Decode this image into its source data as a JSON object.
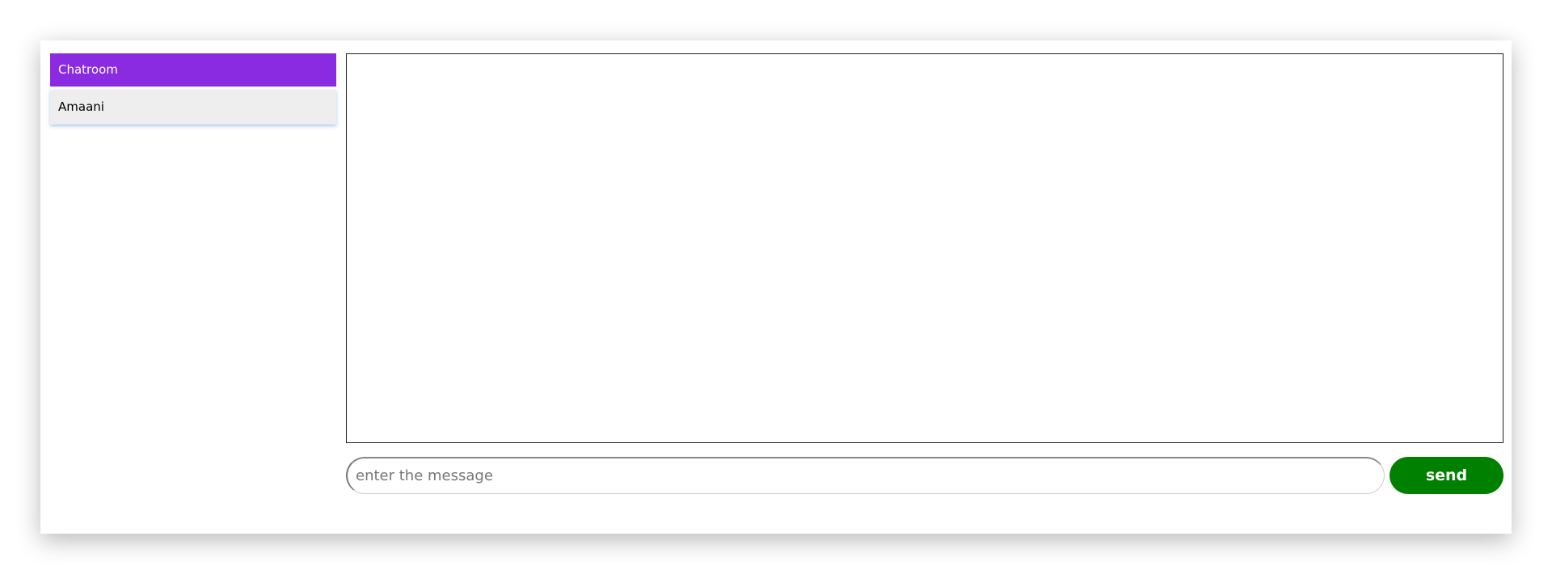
{
  "sidebar": {
    "header": "Chatroom",
    "items": [
      {
        "label": "Amaani"
      }
    ]
  },
  "composer": {
    "placeholder": "enter the message",
    "value": "",
    "send_label": "send"
  },
  "colors": {
    "header_bg": "#8a2be2",
    "send_bg": "#008000",
    "item_bg": "#eeeeee"
  }
}
